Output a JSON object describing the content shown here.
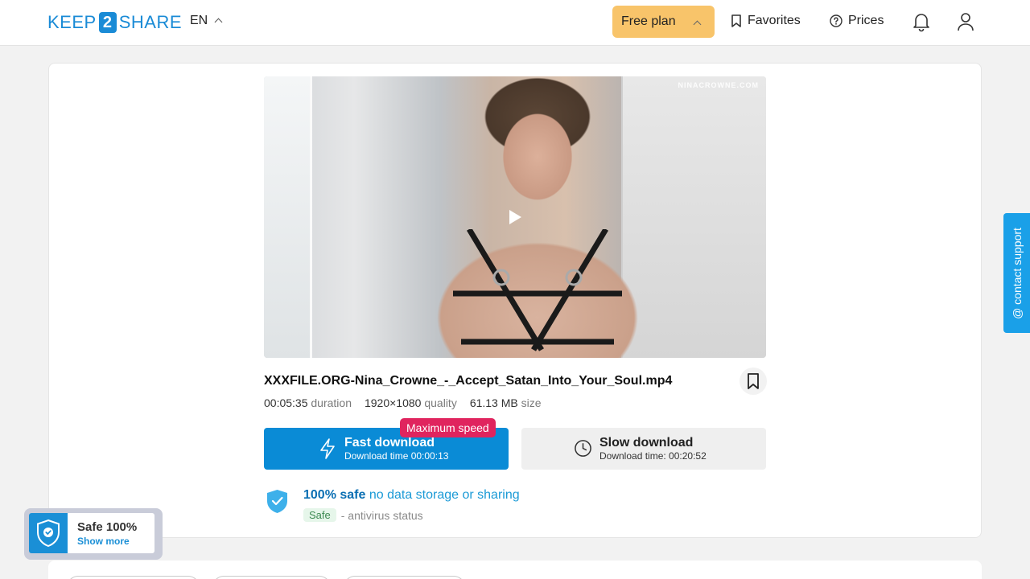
{
  "header": {
    "logo_left": "KEEP",
    "logo_mid": "2",
    "logo_right": "SHARE",
    "language": "EN",
    "free_plan_label": "Free plan",
    "favorites_label": "Favorites",
    "prices_label": "Prices",
    "icons": [
      "bookmark-icon",
      "question-circle-icon",
      "bell-icon",
      "user-icon"
    ]
  },
  "video": {
    "watermark": "NINACROWNE.COM"
  },
  "file": {
    "name": "XXXFILE.ORG-Nina_Crowne_-_Accept_Satan_Into_Your_Soul.mp4",
    "duration_value": "00:05:35",
    "duration_label": "duration",
    "quality_value": "1920×1080",
    "quality_label": "quality",
    "size_value": "61.13 MB",
    "size_label": "size"
  },
  "download": {
    "badge": "Maximum speed",
    "fast_title": "Fast download",
    "fast_time": "Download time 00:00:13",
    "slow_title": "Slow download",
    "slow_time": "Download time: 00:20:52"
  },
  "safety": {
    "bold": "100% safe",
    "link": "no data storage or sharing",
    "status_pill": "Safe",
    "status_text": "- antivirus status"
  },
  "support_label": "@ contact support",
  "safe_widget": {
    "title": "Safe 100%",
    "link": "Show more"
  },
  "colors": {
    "primary": "#0a8bd6",
    "plan": "#f8c46a",
    "badge": "#e0245e",
    "support": "#1aa0e8"
  }
}
